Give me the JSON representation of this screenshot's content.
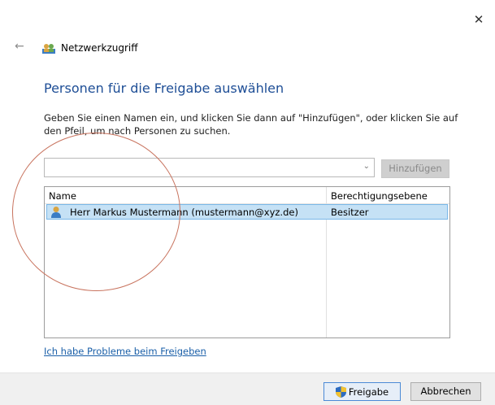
{
  "window": {
    "close_glyph": "✕",
    "back_glyph": "←",
    "title": "Netzwerkzugriff"
  },
  "main": {
    "heading": "Personen für die Freigabe auswählen",
    "instructions": "Geben Sie einen Namen ein, und klicken Sie dann auf \"Hinzufügen\", oder klicken Sie auf den Pfeil, um nach Personen zu suchen.",
    "name_input": {
      "value": "",
      "placeholder": ""
    },
    "add_button_label": "Hinzufügen"
  },
  "table": {
    "columns": [
      "Name",
      "Berechtigungsebene"
    ],
    "rows": [
      {
        "name": "Herr Markus Mustermann (mustermann@xyz.de)",
        "permission": "Besitzer",
        "selected": true
      }
    ]
  },
  "help_link": "Ich habe Probleme beim Freigeben",
  "footer": {
    "share_label": "Freigabe",
    "cancel_label": "Abbrechen"
  },
  "colors": {
    "heading": "#1e4e96",
    "link": "#1a5fa8",
    "selection": "#c5e1f5",
    "annotation_circle": "#c8735e"
  },
  "icons": {
    "title": "network-users-icon",
    "row": "user-icon",
    "share": "uac-shield-icon",
    "dropdown": "chevron-down-icon"
  }
}
